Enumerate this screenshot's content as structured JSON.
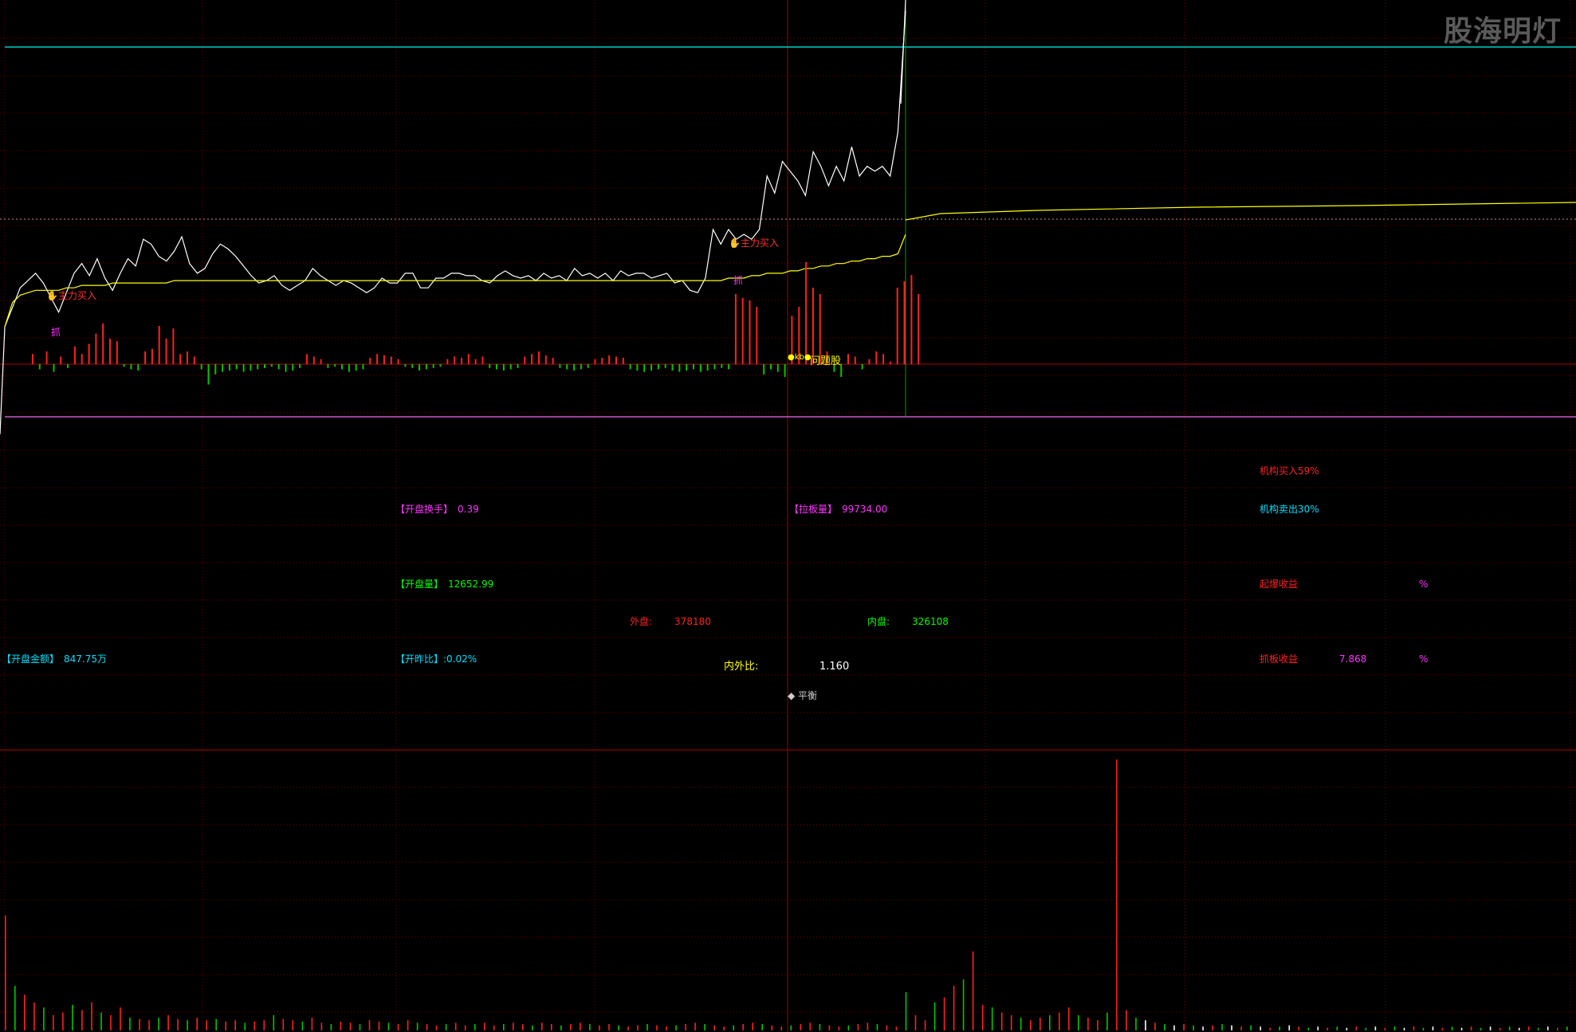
{
  "watermark": "股海明灯",
  "colors": {
    "background": "#000000",
    "grid": "#7a0000",
    "price_line": "#ffffff",
    "avg_line": "#ffff00",
    "cyan_line": "#00cccc",
    "magenta_line": "#cc55cc",
    "up": "#ff2020",
    "down": "#00c800",
    "cyan_text": "#00e0ff",
    "magenta_text": "#ff33ff",
    "green_text": "#00ff00",
    "red_text": "#ff2020",
    "yellow_text": "#ffff00",
    "white_text": "#ffffff"
  },
  "signals": {
    "main_buy_1": "主力买入",
    "main_buy_2": "主力买入",
    "zhua_1": "抓",
    "zhua_2": "抓",
    "problem": "问题股",
    "kb": "kb"
  },
  "indicators": {
    "open_turnover": {
      "label": "【开盘换手】",
      "value": "0.39"
    },
    "limit_volume": {
      "label": "【拉板量】",
      "value": "99734.00"
    },
    "inst_buy": "机构买入59%",
    "inst_sell": "机构卖出30%",
    "open_volume": {
      "label": "【开盘量】",
      "value": "12652.99"
    },
    "qibao": {
      "label": "起爆收益",
      "value": "",
      "unit": "%"
    },
    "outer": {
      "label": "外盘:",
      "value": "378180"
    },
    "inner": {
      "label": "内盘:",
      "value": "326108"
    },
    "open_amount": {
      "label": "【开盘金额】",
      "value": "847.75万"
    },
    "open_ratio": {
      "label": "【开昨比】",
      "value": ":0.02%"
    },
    "inner_outer_ratio": {
      "label": "内外比:",
      "value": "1.160"
    },
    "zhuaban": {
      "label": "抓板收益",
      "value": "7.868",
      "unit": "%"
    },
    "balance": "◆ 平衡"
  },
  "price_series": [
    0,
    8,
    16,
    19,
    22,
    18,
    12,
    6,
    14,
    22,
    26,
    21,
    28,
    20,
    15,
    22,
    28,
    25,
    36,
    34,
    29,
    27,
    31,
    37,
    26,
    22,
    24,
    30,
    34,
    32,
    29,
    25,
    21,
    18,
    19,
    21,
    17,
    15,
    17,
    19,
    24,
    21,
    19,
    17,
    19,
    18,
    16,
    14,
    16,
    20,
    18,
    18,
    22,
    22,
    16,
    16,
    20,
    20,
    22,
    22,
    21,
    21,
    19,
    18,
    21,
    23,
    21,
    20,
    21,
    19,
    22,
    20,
    21,
    19,
    24,
    21,
    22,
    20,
    22,
    19,
    23,
    21,
    22,
    22,
    20,
    21,
    22,
    18,
    19,
    15,
    14,
    20,
    40,
    34,
    40,
    36,
    38,
    36,
    40,
    62,
    55,
    68,
    64,
    60,
    54,
    72,
    66,
    58,
    66,
    60,
    74,
    62,
    66,
    64,
    66,
    62,
    80,
    130
  ],
  "avg_series": [
    0,
    10,
    13,
    14,
    15,
    15,
    15,
    15,
    16,
    16,
    17,
    17,
    17,
    17,
    18,
    18,
    18,
    18,
    18,
    18,
    18,
    18,
    19,
    19,
    19,
    19,
    19,
    19,
    19,
    19,
    19,
    19,
    19,
    19,
    19,
    19,
    19,
    19,
    19,
    19,
    19,
    19,
    19,
    19,
    19,
    19,
    19,
    19,
    19,
    19,
    19,
    19,
    19,
    19,
    19,
    19,
    19,
    19,
    19,
    19,
    19,
    19,
    19,
    19,
    19,
    19,
    19,
    19,
    19,
    19,
    19,
    19,
    19,
    19,
    19,
    19,
    19,
    19,
    19,
    19,
    19,
    19,
    19,
    19,
    19,
    19,
    19,
    19,
    19,
    19,
    19,
    19,
    19,
    19,
    20,
    20,
    20,
    21,
    21,
    22,
    22,
    22,
    23,
    23,
    24,
    24,
    25,
    25,
    26,
    26,
    27,
    27,
    28,
    28,
    29,
    29,
    30,
    38
  ],
  "signal_bars": [
    8,
    -4,
    10,
    -6,
    6,
    -3,
    14,
    8,
    16,
    24,
    32,
    20,
    18,
    -2,
    -4,
    -5,
    10,
    12,
    30,
    20,
    28,
    8,
    10,
    6,
    -4,
    -16,
    -8,
    -6,
    -5,
    -4,
    -6,
    -5,
    -4,
    -3,
    -2,
    -4,
    -6,
    -5,
    -3,
    8,
    6,
    4,
    -3,
    -2,
    -4,
    -6,
    -5,
    -4,
    5,
    8,
    7,
    6,
    4,
    -2,
    -3,
    -5,
    -4,
    -3,
    -2,
    4,
    6,
    5,
    8,
    4,
    6,
    -3,
    -4,
    -5,
    -4,
    -3,
    6,
    8,
    10,
    7,
    5,
    -3,
    -4,
    -5,
    -4,
    -3,
    4,
    5,
    7,
    6,
    5,
    -4,
    -5,
    -6,
    -5,
    -4,
    -3,
    -5,
    -6,
    -5,
    -4,
    -6,
    -5,
    -4,
    -3,
    -4,
    55,
    52,
    50,
    45,
    -8,
    -4,
    -6,
    -10,
    38,
    45,
    80,
    60,
    55,
    10,
    -6,
    -10,
    8,
    6,
    -4,
    4,
    10,
    8,
    2,
    60,
    65,
    70,
    55
  ],
  "volume_bars": [
    90,
    35,
    28,
    22,
    18,
    12,
    14,
    20,
    16,
    22,
    14,
    12,
    18,
    10,
    9,
    8,
    10,
    12,
    9,
    8,
    10,
    8,
    9,
    7,
    8,
    6,
    7,
    8,
    12,
    9,
    8,
    7,
    10,
    6,
    5,
    7,
    6,
    5,
    8,
    7,
    6,
    5,
    8,
    6,
    5,
    4,
    5,
    6,
    4,
    5,
    6,
    4,
    5,
    6,
    5,
    4,
    6,
    5,
    4,
    5,
    6,
    5,
    4,
    5,
    4,
    3,
    4,
    5,
    4,
    3,
    4,
    5,
    6,
    5,
    4,
    3,
    4,
    5,
    6,
    5,
    4,
    3,
    4,
    5,
    6,
    5,
    4,
    3,
    4,
    5,
    6,
    5,
    4,
    3,
    30,
    12,
    8,
    22,
    26,
    35,
    40,
    62,
    20,
    18,
    14,
    12,
    10,
    8,
    10,
    12,
    14,
    18,
    12,
    10,
    8,
    14,
    250,
    16,
    10,
    8,
    6,
    5,
    4,
    5,
    4,
    3,
    4,
    5,
    4,
    3,
    4,
    3,
    2,
    3,
    4,
    3,
    2,
    3,
    2,
    3,
    2,
    3,
    2,
    3,
    2,
    3,
    2,
    3,
    2,
    3,
    2,
    3,
    2,
    3,
    2,
    3,
    2,
    3,
    2,
    3,
    2,
    3,
    2,
    3
  ]
}
